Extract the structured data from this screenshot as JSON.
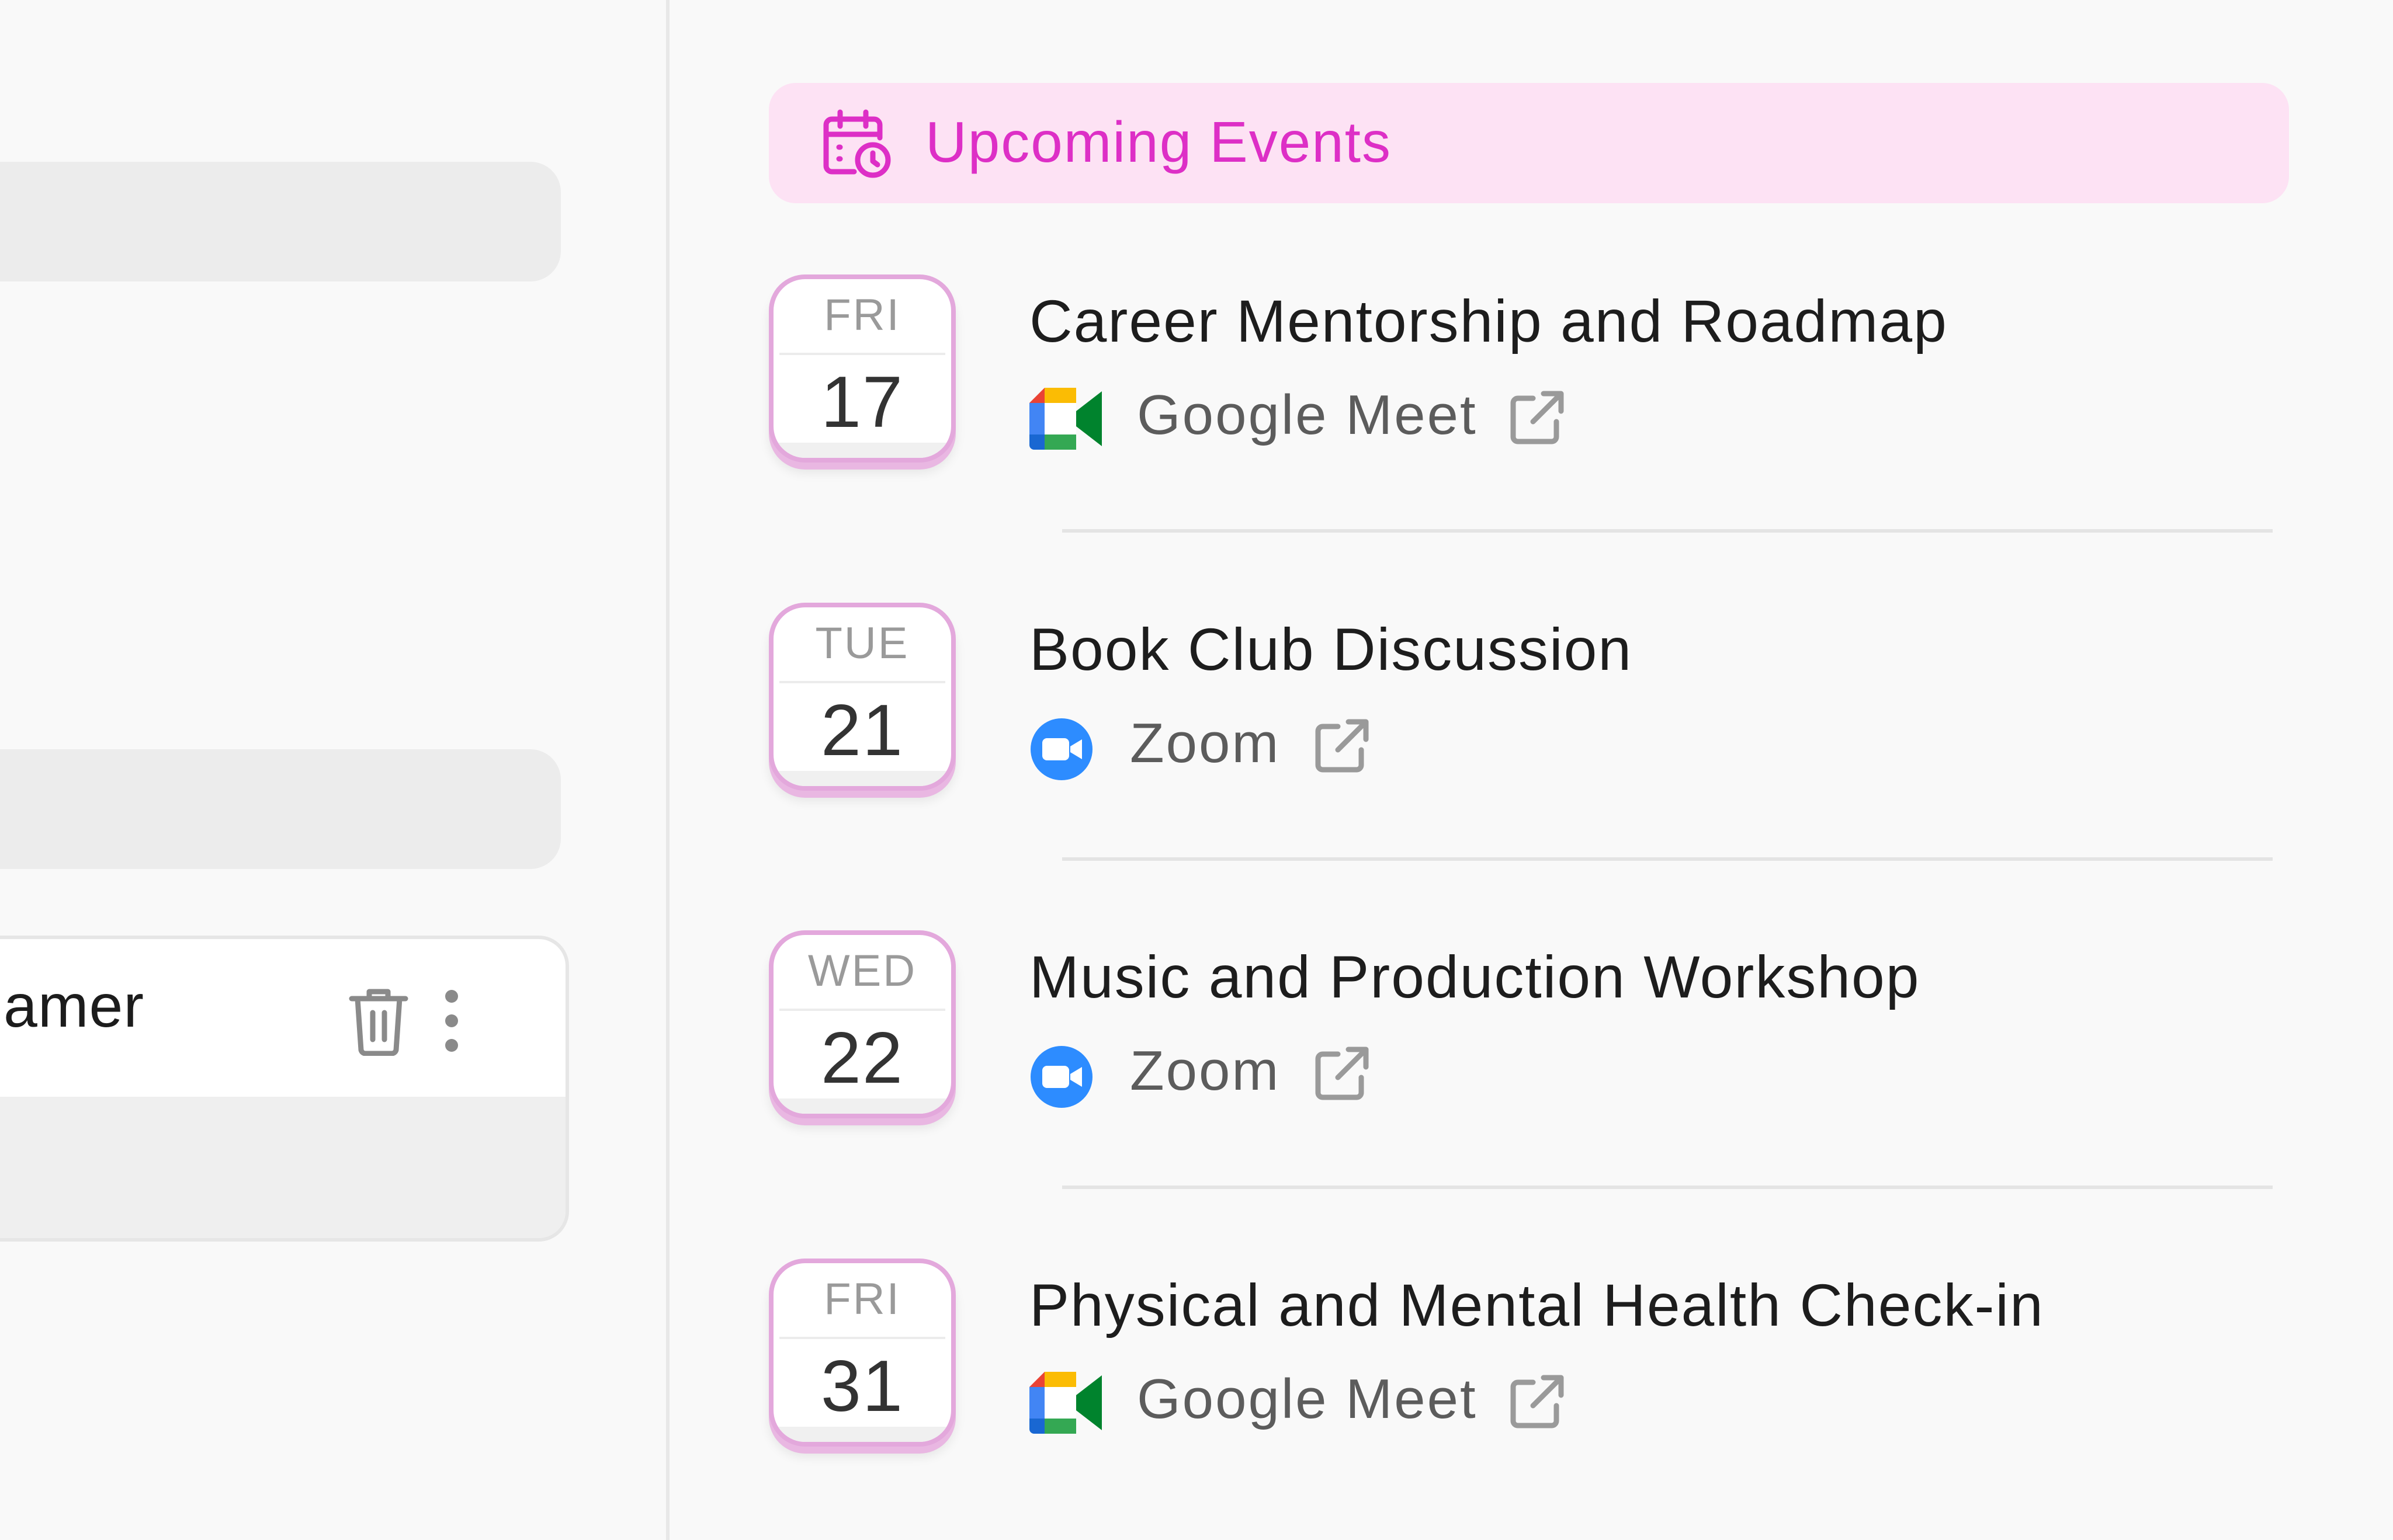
{
  "sidebar": {
    "card": {
      "title": "amer"
    }
  },
  "upcoming": {
    "header": "Upcoming Events",
    "colors": {
      "accent": "#dd2fc6",
      "banner_bg": "#fde2f4",
      "badge_border": "#e3a8dc",
      "google_meet": [
        "#ea4335",
        "#fbbc04",
        "#34a853",
        "#4285f4"
      ],
      "zoom_blue": "#2d8cff"
    },
    "events": [
      {
        "dow": "FRI",
        "day": "17",
        "title": "Career Mentorship and Roadmap",
        "platform": "Google Meet",
        "platform_icon": "google-meet-icon"
      },
      {
        "dow": "TUE",
        "day": "21",
        "title": "Book Club Discussion",
        "platform": "Zoom",
        "platform_icon": "zoom-icon"
      },
      {
        "dow": "WED",
        "day": "22",
        "title": "Music and Production Workshop",
        "platform": "Zoom",
        "platform_icon": "zoom-icon"
      },
      {
        "dow": "FRI",
        "day": "31",
        "title": "Physical and Mental Health Check-in",
        "platform": "Google Meet",
        "platform_icon": "google-meet-icon"
      }
    ]
  }
}
